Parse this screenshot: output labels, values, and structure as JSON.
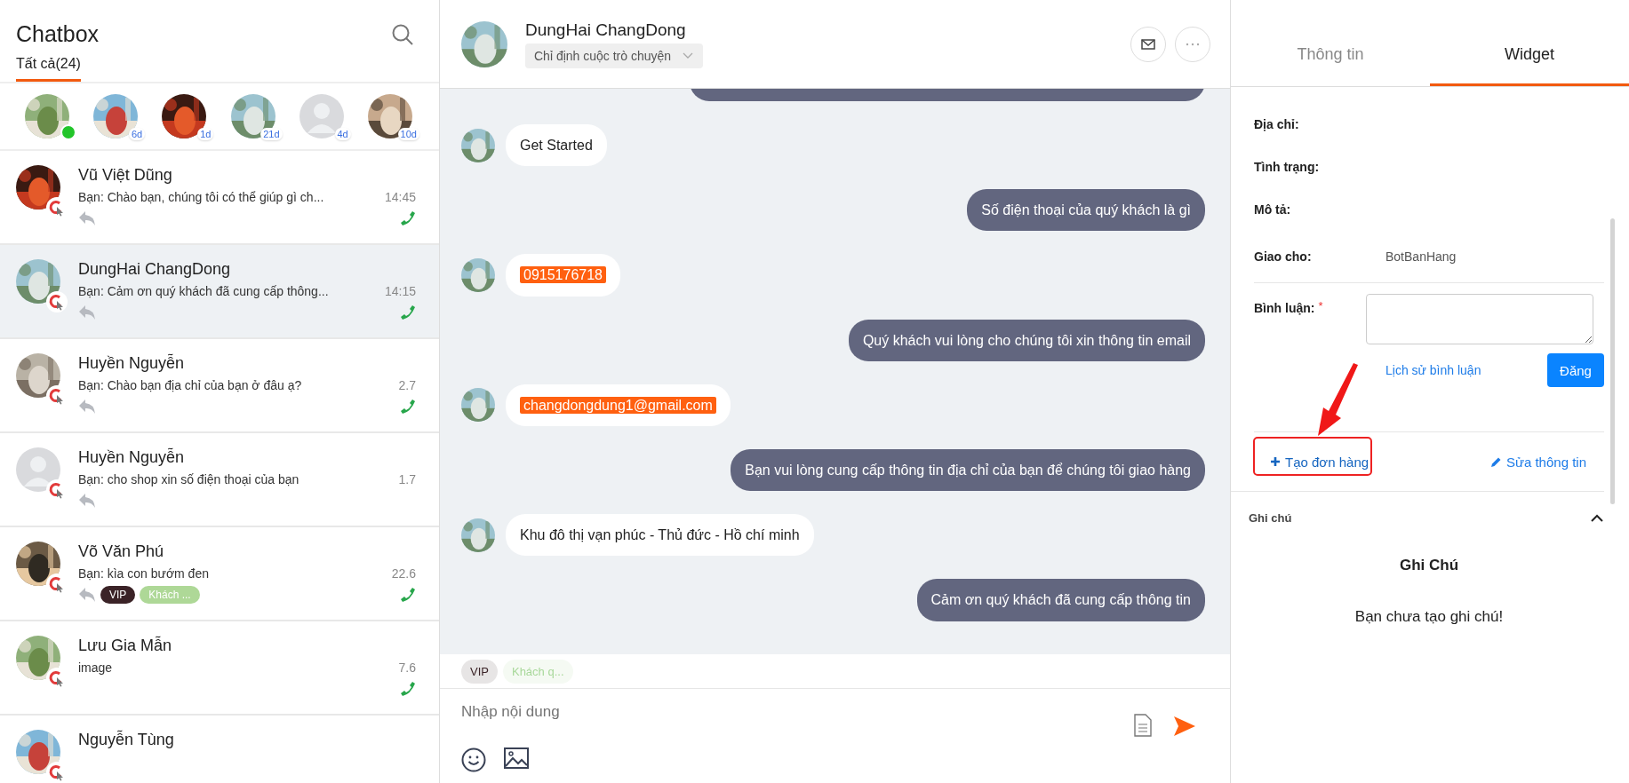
{
  "sidebar": {
    "title": "Chatbox",
    "tabs": [
      {
        "label": "Tất cả(24)",
        "selected": true
      }
    ],
    "stories": [
      {
        "online": true
      },
      {
        "online": false,
        "badge": "6d"
      },
      {
        "online": false,
        "badge": "1d"
      },
      {
        "online": false,
        "badge": "21d"
      },
      {
        "avatar": {
          "kind": "default"
        },
        "online": false,
        "badge": "4d"
      },
      {
        "online": false,
        "badge": "10d"
      }
    ],
    "conversations": [
      {
        "name": "Vũ Việt Dũng",
        "preview": "Bạn: Chào bạn, chúng tôi có thể giúp gì ch...",
        "time": "14:45",
        "replied": true,
        "call": true,
        "selected": false
      },
      {
        "name": "DungHai ChangDong",
        "preview": "Bạn: Cảm ơn quý khách đã cung cấp thông...",
        "time": "14:15",
        "replied": true,
        "call": true,
        "selected": true
      },
      {
        "name": "Huyền Nguyễn",
        "preview": "Bạn: Chào bạn địa chỉ của bạn ở đâu ạ?",
        "time": "2.7",
        "replied": true,
        "call": true,
        "selected": false
      },
      {
        "name": "Huyền Nguyễn",
        "preview": "Bạn: cho shop xin số điện thoại của bạn",
        "time": "1.7",
        "avatar": {
          "kind": "default"
        },
        "replied": true,
        "call": false,
        "selected": false
      },
      {
        "name": "Võ Văn Phú",
        "preview": "Bạn: kìa con bướm đen",
        "time": "22.6",
        "replied": true,
        "call": true,
        "selected": false,
        "tags": [
          {
            "label": "VIP",
            "color": "#3b2327"
          },
          {
            "label": "Khách ...",
            "color": "#aed897"
          }
        ]
      },
      {
        "name": "Lưu Gia Mẫn",
        "preview": " image",
        "time": "7.6",
        "replied": false,
        "call": true,
        "selected": false
      },
      {
        "name": "Nguyễn Tùng",
        "selected": false
      }
    ]
  },
  "chat": {
    "title": "DungHai ChangDong",
    "assign": "Chỉ định cuộc trò chuyện",
    "messages": [
      {
        "kind": "outgoing",
        "clipped": true
      },
      {
        "kind": "incoming",
        "text": "Get Started",
        "highlight": false
      },
      {
        "kind": "outgoing",
        "text": "Số điện thoại của quý khách là gì",
        "highlight": false
      },
      {
        "kind": "incoming",
        "text": "0915176718",
        "highlight": true
      },
      {
        "kind": "outgoing",
        "text": "Quý khách vui lòng cho chúng tôi xin thông tin email",
        "highlight": false
      },
      {
        "kind": "incoming",
        "text": "changdongdung1@gmail.com",
        "highlight": true
      },
      {
        "kind": "outgoing",
        "text": "Bạn vui lòng cung cấp thông tin địa chỉ của bạn để chúng tôi giao hàng",
        "highlight": false
      },
      {
        "kind": "incoming",
        "text": "Khu đô thị vạn phúc - Thủ đức - Hồ chí minh",
        "highlight": false
      },
      {
        "kind": "outgoing",
        "text": "Cảm ơn quý khách đã cung cấp thông tin",
        "highlight": false
      }
    ],
    "tags": [
      {
        "label": "VIP",
        "color": "#3b2327"
      },
      {
        "label": "Khách q...",
        "color": "#a8d89a"
      }
    ],
    "input": {
      "placeholder": "Nhập nội dung"
    }
  },
  "details": {
    "tabs": [
      {
        "label": "Thông tin",
        "selected": false
      },
      {
        "label": "Widget",
        "selected": true
      }
    ],
    "fields": [
      {
        "label": "Địa chỉ:"
      },
      {
        "label": "Tình trạng:"
      },
      {
        "label": "Mô tả:"
      },
      {
        "label": "Giao cho:",
        "value": "BotBanHang"
      }
    ],
    "comment": {
      "label": "Bình luận:",
      "required": "*",
      "history": "Lịch sử bình luận",
      "submit": "Đăng"
    },
    "create_order": "Tạo đơn hàng",
    "edit_info": "Sửa thông tin",
    "notes": {
      "header": "Ghi chú",
      "expanded": true,
      "title": "Ghi Chú",
      "empty": "Bạn chưa tạo ghi chú!"
    }
  }
}
